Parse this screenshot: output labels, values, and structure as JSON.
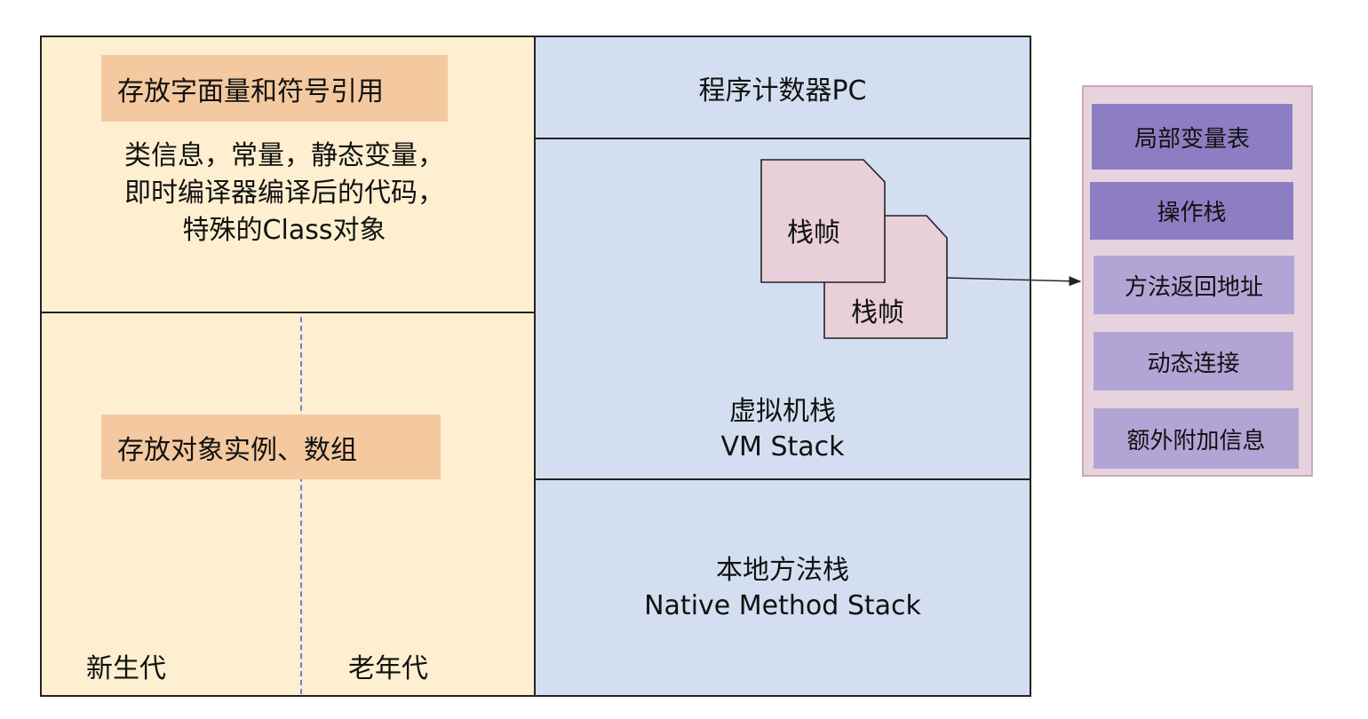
{
  "method_area": {
    "highlight_label": "存放字面量和符号引用",
    "description_lines": [
      "类信息，常量，静态变量，",
      "即时编译器编译后的代码，",
      "特殊的Class对象"
    ]
  },
  "heap": {
    "highlight_label": "存放对象实例、数组",
    "young_generation_label": "新生代",
    "old_generation_label": "老年代"
  },
  "program_counter": {
    "label": "程序计数器PC"
  },
  "vm_stack": {
    "frames": [
      "栈帧",
      "栈帧"
    ],
    "title_cn": "虚拟机栈",
    "title_en": "VM Stack"
  },
  "native_method_stack": {
    "title_cn": "本地方法栈",
    "title_en": "Native Method Stack"
  },
  "frame_details": {
    "items": [
      "局部变量表",
      "操作栈",
      "方法返回地址",
      "动态连接",
      "额外附加信息"
    ]
  },
  "colors": {
    "heap_fill": "#fdefcf",
    "highlight_fill": "#f4c9a0",
    "stack_fill": "#d3dff0",
    "frame_fill": "#e8d0da",
    "panel_fill": "#e6d3dd",
    "dark_item": "#8d7dc2",
    "light_item": "#b3a4d6",
    "generation_divider": "#6b7fe0"
  }
}
